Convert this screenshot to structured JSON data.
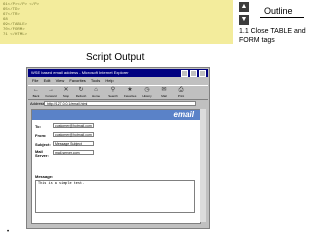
{
  "code_lines": [
    "61</P></P> </P>",
    "65</TD>",
    "67</TR>",
    "68",
    "69</TABLE>",
    "70</FORM>",
    "71 </HTML>"
  ],
  "nav": {
    "up_icon": "triangle-up-icon",
    "down_icon": "triangle-down-icon"
  },
  "outline": {
    "title": "Outline",
    "items": [
      "1.1 Close TABLE and FORM tags"
    ]
  },
  "script_title": "Script Output",
  "browser": {
    "title": "WSE based email address - Microsoft Internet Explorer",
    "menu": [
      "File",
      "Edit",
      "View",
      "Favorites",
      "Tools",
      "Help"
    ],
    "toolbar": [
      {
        "label": "Back",
        "icon": "back-arrow-icon"
      },
      {
        "label": "Forward",
        "icon": "forward-arrow-icon"
      },
      {
        "label": "Stop",
        "icon": "stop-icon"
      },
      {
        "label": "Refresh",
        "icon": "refresh-icon"
      },
      {
        "label": "Home",
        "icon": "home-icon"
      },
      {
        "label": "Search",
        "icon": "search-icon"
      },
      {
        "label": "Favorites",
        "icon": "favorites-icon"
      },
      {
        "label": "History",
        "icon": "history-icon"
      },
      {
        "label": "Mail",
        "icon": "mail-icon"
      },
      {
        "label": "Print",
        "icon": "print-icon"
      }
    ],
    "address_label": "Address",
    "address_value": "http://127.0.0.1/email.html",
    "banner_logo": "email",
    "form": {
      "to_label": "To:",
      "to_value": "customer@hotmail.com",
      "from_label": "From:",
      "from_value": "customer@hotmail.com",
      "subject_label": "Subject:",
      "subject_value": "Message Subject",
      "mail_server_label": "Mail Server:",
      "mail_server_value": "mail.server.com",
      "message_label": "Message:",
      "message_value": "This is a simple test."
    }
  }
}
